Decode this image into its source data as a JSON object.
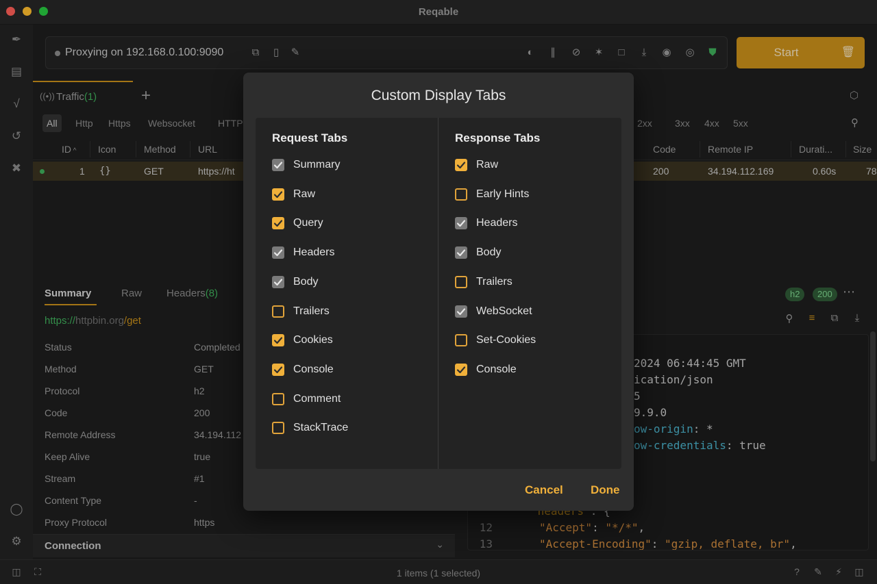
{
  "window": {
    "title": "Reqable"
  },
  "rail": {
    "icons": [
      "compose-icon",
      "layers-icon",
      "function-icon",
      "history-icon",
      "tools-icon",
      "account-icon",
      "settings-icon"
    ]
  },
  "proxy": {
    "text": "Proxying on 192.168.0.100:9090"
  },
  "start": {
    "label": "Start"
  },
  "tabs": {
    "traffic_label": "Traffic",
    "traffic_count": "(1)"
  },
  "filters": [
    "All",
    "Http",
    "Https",
    "Websocket",
    "HTTP",
    "2xx",
    "3xx",
    "4xx",
    "5xx"
  ],
  "table": {
    "columns": [
      "ID",
      "Icon",
      "Method",
      "URL",
      "Code",
      "Remote IP",
      "Durati...",
      "Size"
    ],
    "rows": [
      {
        "id": "1",
        "icon": "{}",
        "method": "GET",
        "url": "https://ht",
        "code": "200",
        "ip": "34.194.112.169",
        "duration": "0.60s",
        "size": "78"
      }
    ]
  },
  "detail": {
    "tabs": {
      "summary": "Summary",
      "raw": "Raw",
      "headers": "Headers",
      "headers_count": "(8)"
    },
    "url": {
      "scheme": "https://",
      "host": "httpbin.org",
      "path": "/get"
    },
    "fields": [
      {
        "key": "Status",
        "value": "Completed"
      },
      {
        "key": "Method",
        "value": "GET"
      },
      {
        "key": "Protocol",
        "value": "h2"
      },
      {
        "key": "Code",
        "value": "200"
      },
      {
        "key": "Remote Address",
        "value": "34.194.112"
      },
      {
        "key": "Keep Alive",
        "value": "true"
      },
      {
        "key": "Stream",
        "value": "#1"
      },
      {
        "key": "Content Type",
        "value": "-"
      },
      {
        "key": "Proxy Protocol",
        "value": "https"
      }
    ],
    "connection": "Connection"
  },
  "response": {
    "badges": [
      "h2",
      "200"
    ],
    "code": {
      "l1": "2024 06:44:45 GMT",
      "l2": "ication/json",
      "l3": "5",
      "l4": "9.9.0",
      "l5_key": "ow-origin",
      "l5_val": ": *",
      "l6_key": "ow-credentials",
      "l6_val": ": true",
      "l11_key": "\"headers\"",
      "l11_val": ": {",
      "l12_num": "12",
      "l12_key": "\"Accept\"",
      "l12_sep": ": ",
      "l12_val": "\"*/*\"",
      "l12_end": ",",
      "l13_num": "13",
      "l13_key": "\"Accept-Encoding\"",
      "l13_sep": ": ",
      "l13_val": "\"gzip, deflate, br\"",
      "l13_end": ","
    }
  },
  "status": {
    "text": "1 items (1 selected)"
  },
  "modal": {
    "title": "Custom Display Tabs",
    "request_heading": "Request Tabs",
    "response_heading": "Response Tabs",
    "request_tabs": [
      {
        "label": "Summary",
        "state": "grey"
      },
      {
        "label": "Raw",
        "state": "on"
      },
      {
        "label": "Query",
        "state": "on"
      },
      {
        "label": "Headers",
        "state": "grey"
      },
      {
        "label": "Body",
        "state": "grey"
      },
      {
        "label": "Trailers",
        "state": "off"
      },
      {
        "label": "Cookies",
        "state": "on"
      },
      {
        "label": "Console",
        "state": "on"
      },
      {
        "label": "Comment",
        "state": "off"
      },
      {
        "label": "StackTrace",
        "state": "off"
      }
    ],
    "response_tabs": [
      {
        "label": "Raw",
        "state": "on"
      },
      {
        "label": "Early Hints",
        "state": "off"
      },
      {
        "label": "Headers",
        "state": "grey"
      },
      {
        "label": "Body",
        "state": "grey"
      },
      {
        "label": "Trailers",
        "state": "off"
      },
      {
        "label": "WebSocket",
        "state": "grey"
      },
      {
        "label": "Set-Cookies",
        "state": "off"
      },
      {
        "label": "Console",
        "state": "on"
      }
    ],
    "cancel": "Cancel",
    "done": "Done"
  },
  "colors": {
    "accent": "#f0b03a",
    "start": "#c98f1a",
    "success": "#3fae5b"
  }
}
